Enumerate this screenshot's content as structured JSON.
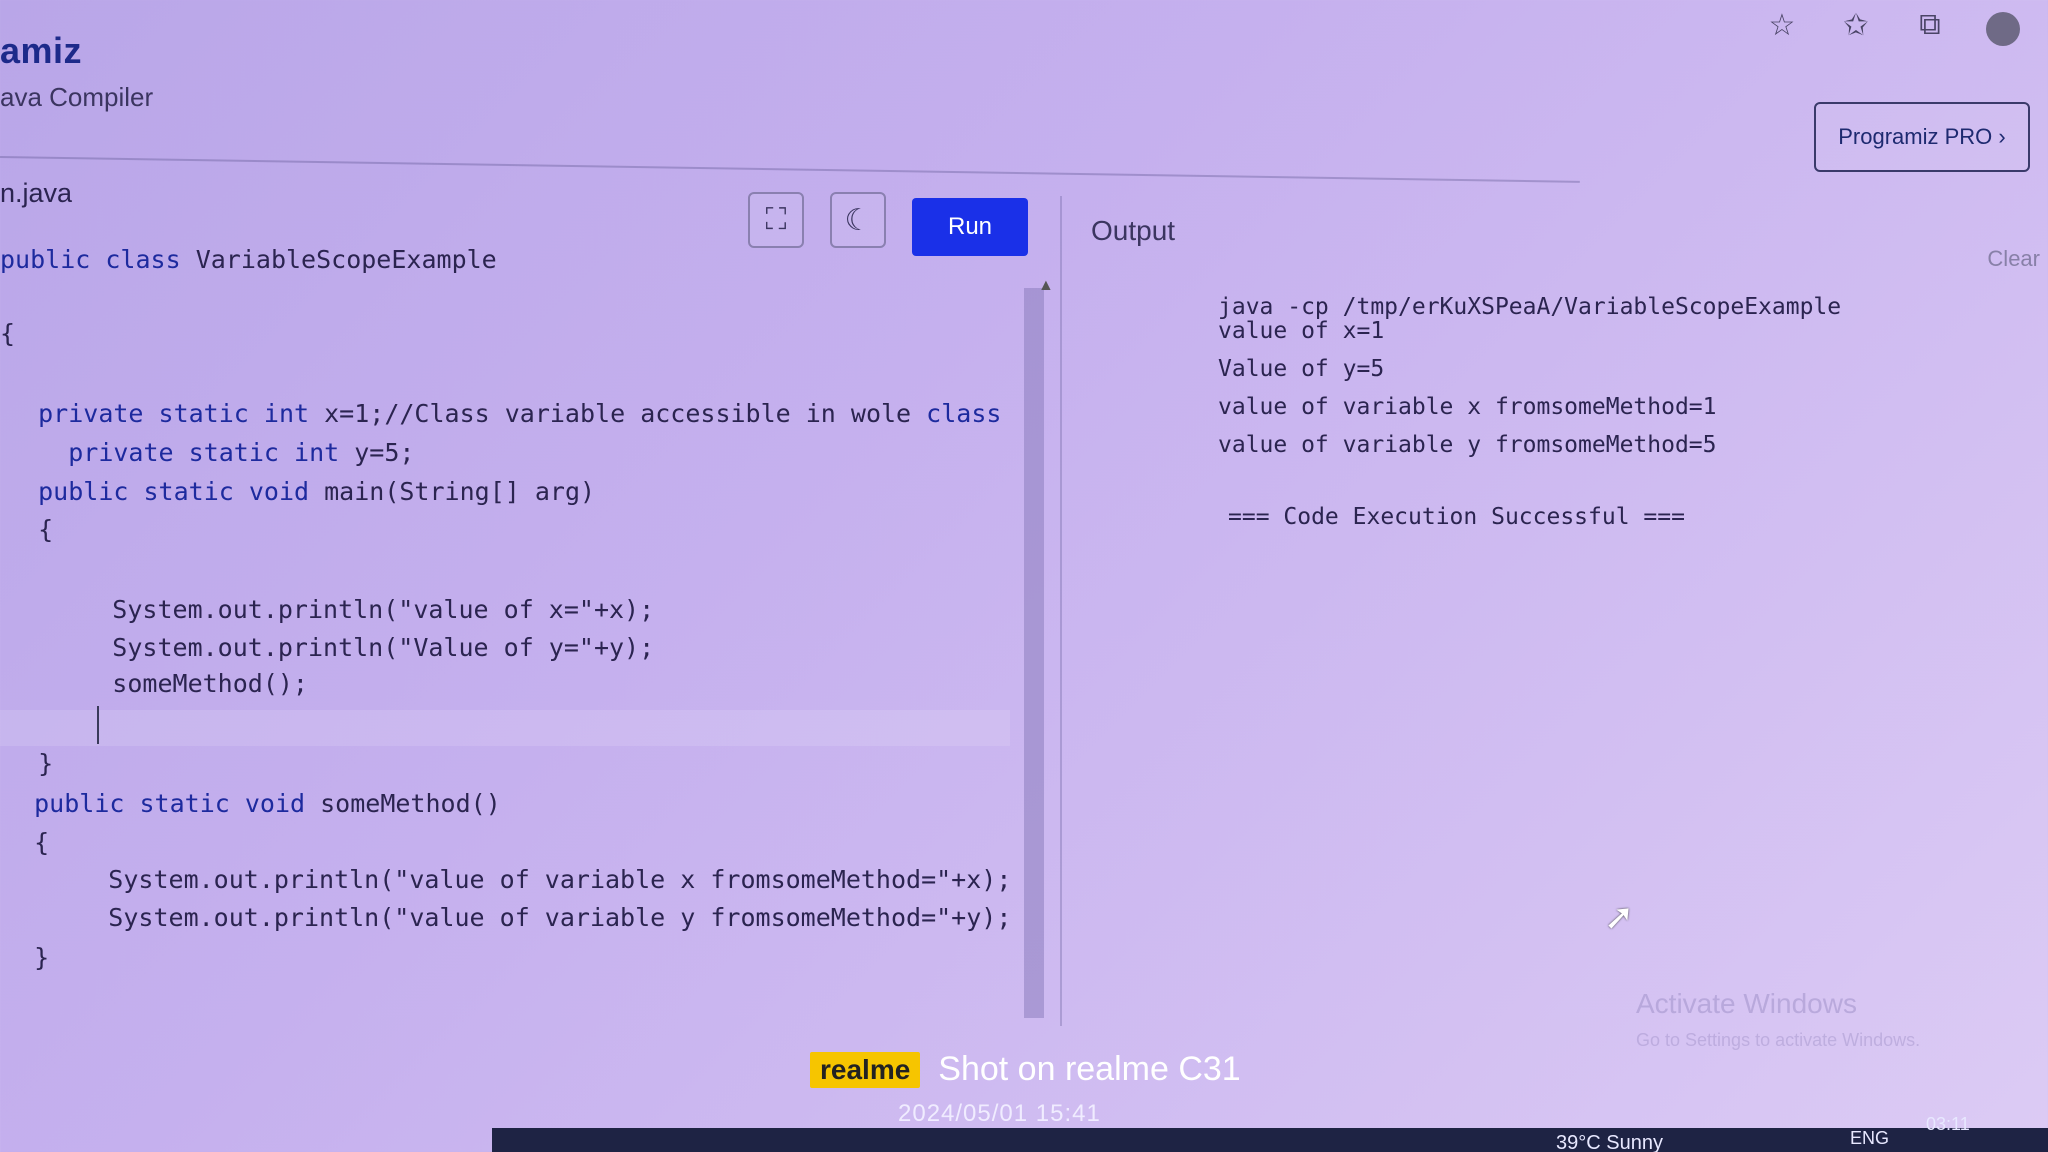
{
  "header": {
    "brand": "amiz",
    "subtitle": "ava Compiler",
    "pro_button": "Programiz PRO ›",
    "browser_icons": [
      "star-plus-icon",
      "favorites-icon",
      "collections-icon",
      "profile-avatar"
    ]
  },
  "editor": {
    "file_tab": "n.java",
    "run_label": "Run",
    "code_lines": [
      "public class VariableScopeExample",
      "{",
      "  private static int x=1;//Class variable accessible in wole class",
      "    private static int y=5;",
      "  public static void main(String[] arg)",
      "  {",
      "      System.out.println(\"value of x=\"+x);",
      "      System.out.println(\"Value of y=\"+y);",
      "      someMethod();",
      "  }",
      "  public static void someMethod()",
      "  {",
      "      System.out.println(\"value of variable x fromsomeMethod=\"+x);",
      "      System.out.println(\"value of variable y fromsomeMethod=\"+y);",
      "  }"
    ]
  },
  "output": {
    "title": "Output",
    "clear_label": "Clear",
    "lines": [
      "java -cp /tmp/erKuXSPeaA/VariableScopeExample",
      "value of x=1",
      "Value of y=5",
      "value of variable x fromsomeMethod=1",
      "value of variable y fromsomeMethod=5",
      "=== Code Execution Successful ==="
    ]
  },
  "overlay": {
    "activate_title": "Activate Windows",
    "activate_sub": "Go to Settings to activate Windows.",
    "realme_badge": "realme",
    "realme_text": "Shot on realme C31",
    "shot_date": "2024/05/01  15:41"
  },
  "taskbar": {
    "weather": "39°C  Sunny",
    "lang": "ENG",
    "clock": "03:11"
  }
}
